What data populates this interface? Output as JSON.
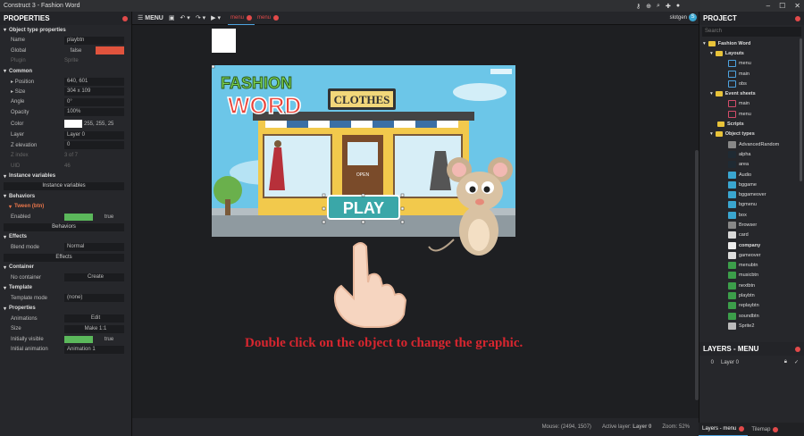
{
  "window": {
    "title": "Construct 3 - Fashion Word"
  },
  "toolbar": {
    "menu_label": "MENU",
    "tabs": [
      "menu",
      "menu"
    ],
    "user": "slotgen",
    "avatar_initial": "S"
  },
  "properties": {
    "header": "PROPERTIES",
    "object_section": "Object type properties",
    "name_label": "Name",
    "name_value": "playbtn",
    "global_label": "Global",
    "global_value": "false",
    "plugin_label": "Plugin",
    "plugin_value": "Sprite",
    "common_section": "Common",
    "position_label": "Position",
    "position_value": "640, 601",
    "size_label": "Size",
    "size_value": "304 x 109",
    "angle_label": "Angle",
    "angle_value": "0°",
    "opacity_label": "Opacity",
    "opacity_value": "100%",
    "color_label": "Color",
    "color_value": "255, 255, 25",
    "layer_label": "Layer",
    "layer_value": "Layer 0",
    "zelev_label": "Z elevation",
    "zelev_value": "0",
    "zindex_label": "Z index",
    "zindex_value": "3 of 7",
    "uid_label": "UID",
    "uid_value": "46",
    "instvars_section": "Instance variables",
    "instvars_button": "Instance variables",
    "behaviors_section": "Behaviors",
    "tween_label": "Tween (btn)",
    "enabled_label": "Enabled",
    "enabled_value": "true",
    "behaviors_button": "Behaviors",
    "effects_section": "Effects",
    "blend_label": "Blend mode",
    "blend_value": "Normal",
    "effects_button": "Effects",
    "container_section": "Container",
    "nocontainer_label": "No container",
    "create_button": "Create",
    "template_section": "Template",
    "tmode_label": "Template mode",
    "tmode_value": "(none)",
    "props_section": "Properties",
    "anim_label": "Animations",
    "edit_button": "Edit",
    "size2_label": "Size",
    "make_button": "Make 1:1",
    "visible_label": "Initially visible",
    "visible_value": "true",
    "initanim_label": "Initial animation",
    "initanim_value": "Animation 1"
  },
  "canvas": {
    "instruction": "Double click on the object to change the graphic.",
    "logo_line1": "FASHION",
    "logo_line2": "WORD",
    "shop_sign": "CLOTHES",
    "play_label": "PLAY",
    "door_sign": "OPEN"
  },
  "status": {
    "mouse": "Mouse: (2494, 1507)",
    "active_layer_prefix": "Active layer:",
    "active_layer": "Layer 0",
    "zoom": "Zoom: 52%"
  },
  "project": {
    "header": "PROJECT",
    "search_placeholder": "Search",
    "root": "Fashion Word",
    "layouts_folder": "Layouts",
    "layouts": [
      "menu",
      "main",
      "obs"
    ],
    "events_folder": "Event sheets",
    "events": [
      "main",
      "menu"
    ],
    "scripts_folder": "Scripts",
    "objects_folder": "Object types",
    "objects": [
      "AdvancedRandom",
      "alpha",
      "area",
      "Audio",
      "bggame",
      "bggameover",
      "bgmenu",
      "box",
      "Browser",
      "card",
      "company",
      "gameover",
      "menubtn",
      "musicbtn",
      "nextbtn",
      "playbtn",
      "replaybtn",
      "soundbtn",
      "Sprite2"
    ]
  },
  "layers": {
    "header": "LAYERS - MENU",
    "index": "0",
    "name": "Layer 0"
  },
  "bottom_tabs": [
    "Layers - menu",
    "Tilemap"
  ],
  "colors": {
    "accent": "#e24a4a",
    "folder": "#e8c33a",
    "sky": "#6cc6e8"
  }
}
